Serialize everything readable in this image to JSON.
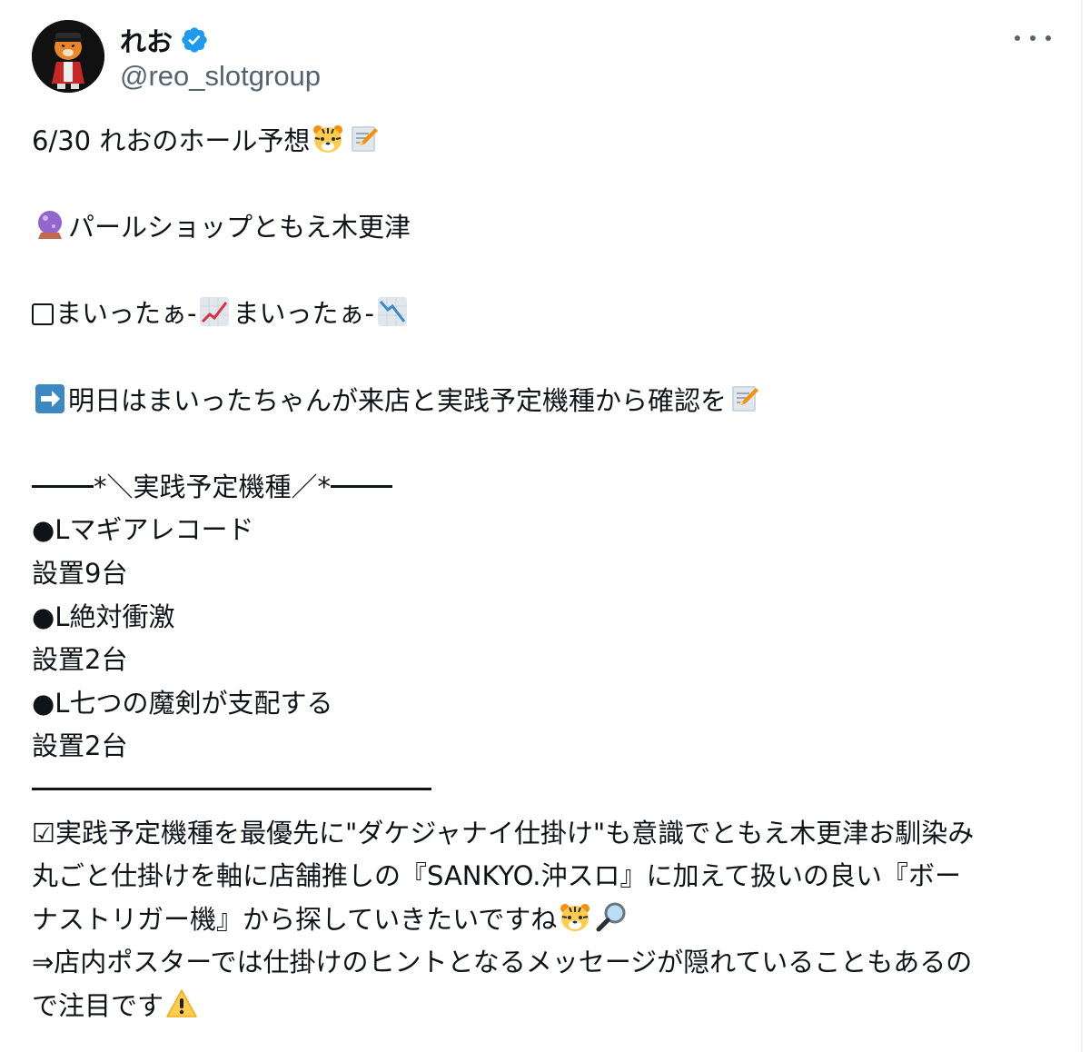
{
  "author": {
    "display_name": "れお",
    "handle": "@reo_slotgroup",
    "avatar_icon": "tiger-avatar-icon",
    "verified_icon": "verified-badge-icon",
    "verified_color": "#1d9bf0"
  },
  "more_icon": "more-options-icon",
  "tweet": {
    "line1": "6/30 れおのホール予想",
    "line2": "パールショップともえ木更津",
    "line3a": "まいったぁ-",
    "line3b": "まいったぁ-",
    "line4": "明日はまいったちゃんが来店と実践予定機種から確認を",
    "section_header_mid": "*＼実践予定機種／*",
    "machine1": "●Lマギアレコード",
    "count1": "設置9台",
    "machine2": "●L絶対衝激",
    "count2": "設置2台",
    "machine3": "●L七つの魔剣が支配する",
    "count3": "設置2台",
    "p1": "☑実践予定機種を最優先に\"ダケジャナイ仕掛け\"も意識でともえ木更津お馴染み",
    "p2": "丸ごと仕掛けを軸に店舗推しの『SANKYO.沖スロ』に加えて扱いの良い『ボー",
    "p3": "ナストリガー機』から探していきたいですね",
    "p4": "⇒店内ポスターでは仕掛けのヒントとなるメッセージが隠れていることもあるの",
    "p5": "で注目です"
  },
  "emoji_names": {
    "tiger": "tiger-face-icon",
    "memo": "memo-icon",
    "crystal_ball": "crystal-ball-icon",
    "chart_up": "chart-increasing-icon",
    "chart_down": "chart-decreasing-icon",
    "arrow_right": "right-arrow-icon",
    "magnifier": "magnifying-glass-icon",
    "warning": "warning-icon",
    "checkbox": "empty-checkbox-icon"
  }
}
